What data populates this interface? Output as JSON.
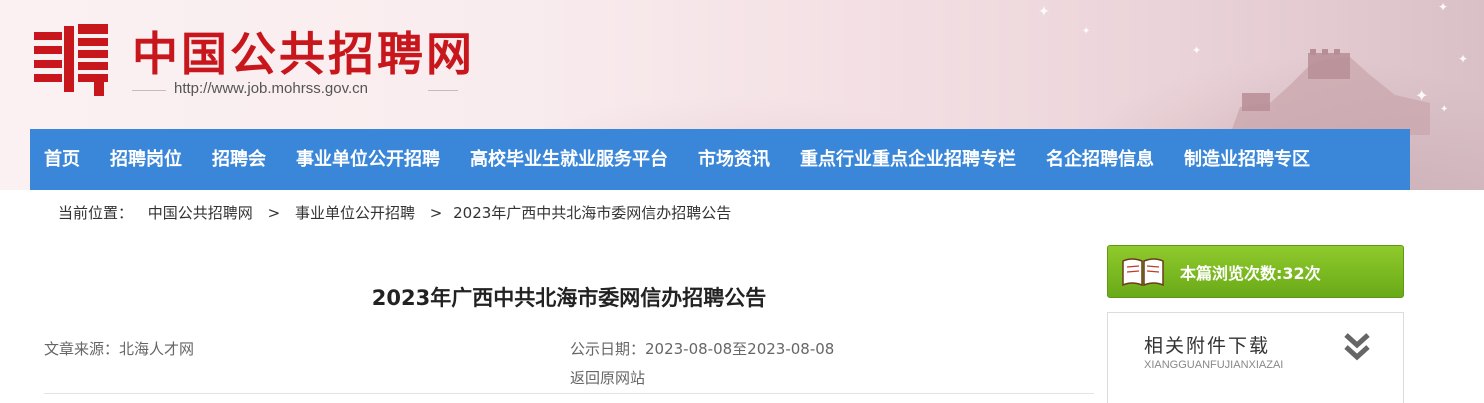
{
  "header": {
    "site_title": "中国公共招聘网",
    "site_url": "http://www.job.mohrss.gov.cn",
    "colors": {
      "brand_red": "#c8161d",
      "nav_blue": "#3a86d8"
    }
  },
  "nav": {
    "items": [
      {
        "label": "首页"
      },
      {
        "label": "招聘岗位"
      },
      {
        "label": "招聘会"
      },
      {
        "label": "事业单位公开招聘"
      },
      {
        "label": "高校毕业生就业服务平台"
      },
      {
        "label": "市场资讯"
      },
      {
        "label": "重点行业重点企业招聘专栏"
      },
      {
        "label": "名企招聘信息"
      },
      {
        "label": "制造业招聘专区"
      }
    ]
  },
  "breadcrumb": {
    "prefix": "当前位置：",
    "items": [
      "中国公共招聘网",
      "事业单位公开招聘",
      "2023年广西中共北海市委网信办招聘公告"
    ],
    "separator": ">"
  },
  "article": {
    "title": "2023年广西中共北海市委网信办招聘公告",
    "source": "文章来源：北海人才网",
    "date": "公示日期：2023-08-08至2023-08-08",
    "back_link": "返回原网站"
  },
  "sidebar": {
    "views_label": "本篇浏览次数:32次",
    "views_icon": "book-icon",
    "attachments_title": "相关附件下载",
    "attachments_pinyin": "XIANGGUANFUJIANXIAZAI",
    "attachments_icon": "chevron-double-down-icon"
  }
}
